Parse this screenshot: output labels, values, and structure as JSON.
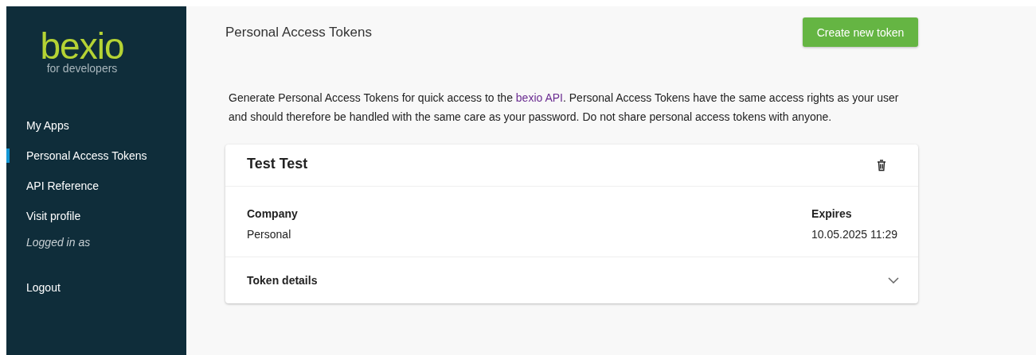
{
  "sidebar": {
    "logo": {
      "wordmark": "bexio",
      "tagline": "for developers"
    },
    "nav": [
      {
        "label": "My Apps",
        "selected": false
      },
      {
        "label": "Personal Access Tokens",
        "selected": true
      },
      {
        "label": "API Reference",
        "selected": false
      },
      {
        "label": "Visit profile",
        "selected": false
      }
    ],
    "logged_in_label": "Logged in as",
    "logout": "Logout"
  },
  "page": {
    "title": "Personal Access Tokens",
    "create_button": "Create new token",
    "description": {
      "before": "Generate Personal Access Tokens for quick access to the ",
      "link": "bexio API",
      "after": ". Personal Access Tokens have the same access rights as your user and should therefore be handled with the same care as your password. Do not share personal access tokens with anyone."
    },
    "tokens": [
      {
        "name": "Test Test",
        "fields": [
          {
            "label": "Company",
            "value": "Personal"
          },
          {
            "label": "Expires",
            "value": "10.05.2025 11:29"
          }
        ],
        "details": {
          "label": "Token details",
          "expanded": false
        }
      }
    ]
  }
}
